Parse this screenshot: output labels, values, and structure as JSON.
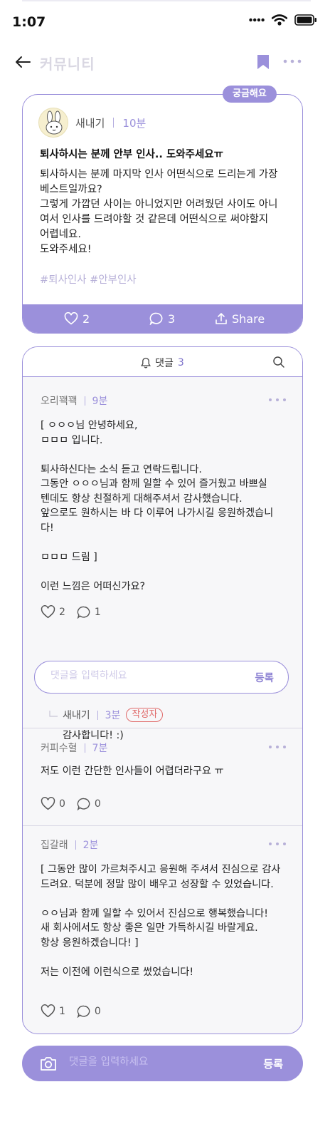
{
  "status_bar": {
    "time": "1:07",
    "signal_icon": "cellular-dots-icon",
    "wifi_icon": "wifi-icon",
    "battery_icon": "battery-icon"
  },
  "app_bar": {
    "title": "커뮤니티",
    "back_icon": "arrow-left-icon",
    "bookmark_icon": "bookmark-icon",
    "more_icon": "more-horizontal-icon"
  },
  "colors": {
    "accent": "#9b90db",
    "accent_light": "#b7b0d8",
    "author_badge": "#e06a6a",
    "background_comments": "#f7f7f9"
  },
  "post": {
    "badge": "궁금해요",
    "author": "새내기",
    "time": "10분",
    "title": "퇴사하시는 분께 안부 인사.. 도와주세요ㅠ",
    "body": "퇴사하시는 분께 마지막 인사 어떤식으로 드리는게 가장\n베스트일까요?\n그렇게 가깝던 사이는 아니었지만 어려웠던 사이도 아니\n여서 인사를 드려야할 것 같은데 어떤식으로 써야할지\n어렵네요.\n도와주세요!",
    "hashtags": "#퇴사인사 #안부인사",
    "likes": "2",
    "comments": "3",
    "share_label": "Share"
  },
  "comments_section": {
    "title": "댓글",
    "count": "3",
    "items": [
      {
        "author": "오리꽥꽥",
        "time": "9분",
        "text": "[ ㅇㅇㅇ님 안녕하세요,\nㅁㅁㅁ 입니다.\n\n퇴사하신다는 소식 듣고 연락드립니다.\n그동안 ㅇㅇㅇ님과 함께 일할 수 있어 즐거웠고 바쁘실\n텐데도 항상 친절하게 대해주셔서 감사했습니다.\n앞으로도 원하시는 바 다 이루어 나가시길 응원하겠습니\n다!\n\nㅁㅁㅁ 드림 ]\n\n이런 느낌은 어떠신가요?",
        "likes": "2",
        "replies": "1"
      },
      {
        "author": "커피수혈",
        "time": "7분",
        "text": "저도 이런 간단한 인사들이 어렵더라구요 ㅠ",
        "likes": "0",
        "replies": "0"
      },
      {
        "author": "집갈래",
        "time": "2분",
        "text": "[ 그동안 많이 가르쳐주시고 응원해 주셔서 진심으로 감사\n드려요. 덕분에 정말 많이 배우고 성장할 수 있었습니다.\n\nㅇㅇ님과 함께 일할 수 있어서 진심으로 행복했습니다!\n새 회사에서도 항상 좋은 일만 가득하시길 바랄게요.\n항상 응원하겠습니다! ]\n\n저는 이전에 이런식으로 썼었습니다!",
        "likes": "1",
        "replies": "0"
      }
    ],
    "reply_input": {
      "placeholder": "댓글을 입력하세요",
      "submit": "등록"
    },
    "reply": {
      "author": "새내기",
      "time": "3분",
      "badge": "작성자",
      "text": "감사합니다! :)"
    }
  },
  "bottom_input": {
    "placeholder": "댓글을 입력하세요",
    "submit": "등록",
    "camera_icon": "camera-icon"
  }
}
